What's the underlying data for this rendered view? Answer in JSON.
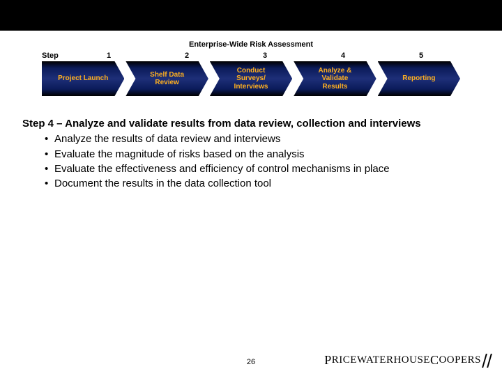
{
  "slide": {
    "title": "Enterprise-Wide Risk Assessment",
    "step_label": "Step",
    "step_numbers": [
      "1",
      "2",
      "3",
      "4",
      "5"
    ],
    "chevrons": [
      "Project Launch",
      "Shelf Data\nReview",
      "Conduct\nSurveys/\nInterviews",
      "Analyze &\nValidate\nResults",
      "Reporting"
    ],
    "heading": "Step 4 – Analyze and validate results from data review, collection and interviews",
    "bullets": [
      "Analyze the results of data review and interviews",
      "Evaluate the magnitude of risks based on the analysis",
      "Evaluate the effectiveness and efficiency of control mechanisms in place",
      "Document the results in the data collection tool"
    ],
    "page_number": "26",
    "brand_1": "P",
    "brand_2": "RICEWATERHOUSE",
    "brand_3": "C",
    "brand_4": "OOPERS"
  },
  "chart_data": {
    "type": "table",
    "title": "Enterprise-Wide Risk Assessment process steps",
    "categories": [
      "1",
      "2",
      "3",
      "4",
      "5"
    ],
    "values": [
      "Project Launch",
      "Shelf Data Review",
      "Conduct Surveys/Interviews",
      "Analyze & Validate Results",
      "Reporting"
    ],
    "highlighted_step": 4
  }
}
